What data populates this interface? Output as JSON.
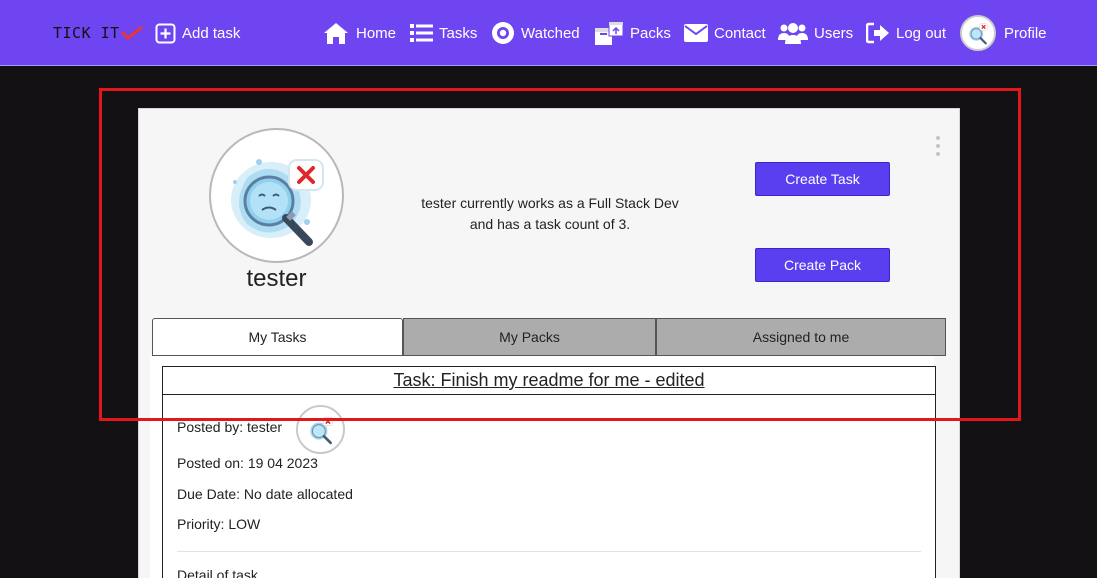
{
  "nav": {
    "logo_text": "TICK IT",
    "add_task": "Add task",
    "home": "Home",
    "tasks": "Tasks",
    "watched": "Watched",
    "packs": "Packs",
    "contact": "Contact",
    "users": "Users",
    "logout": "Log out",
    "profile": "Profile"
  },
  "profile": {
    "username": "tester",
    "bio": "tester currently works as a Full Stack Dev and has a task count of 3.",
    "create_task": "Create Task",
    "create_pack": "Create Pack"
  },
  "tabs": [
    "My Tasks",
    "My Packs",
    "Assigned to me"
  ],
  "task": {
    "title": "Task: Finish my readme for me - edited",
    "posted_by": "Posted by: tester",
    "posted_on": "Posted on: 19 04 2023",
    "due_date": "Due Date: No date allocated",
    "priority": "Priority: LOW",
    "detail": "Detail of task"
  },
  "colors": {
    "navbar": "#6e45f0",
    "button": "#5a3ff0",
    "highlight": "#e0181b",
    "background": "#141115"
  }
}
